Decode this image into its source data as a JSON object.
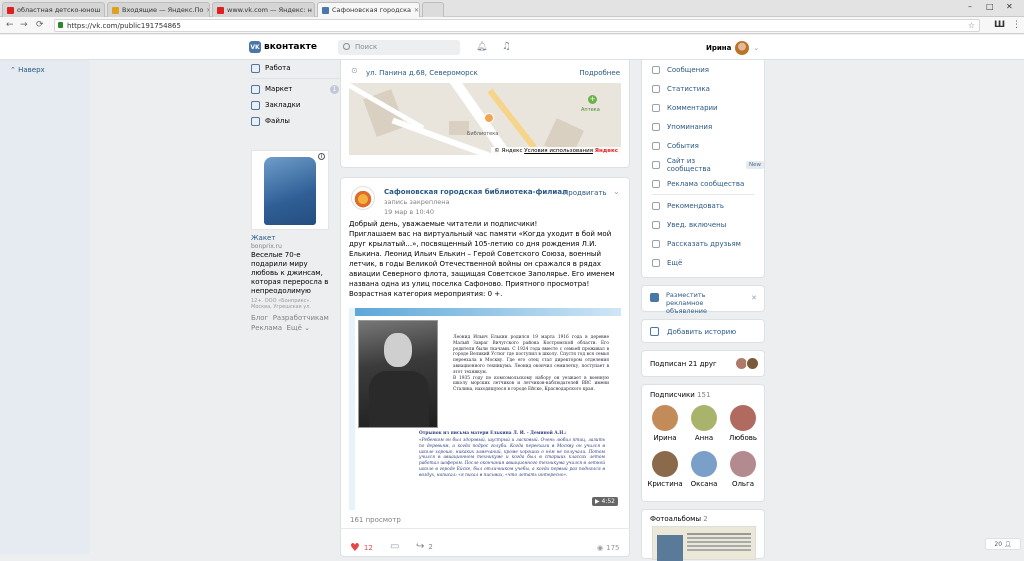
{
  "browser": {
    "tabs": [
      {
        "label": "областная детско-юнош",
        "color": "#e02020"
      },
      {
        "label": "Входящие — Яндекс.По",
        "color": "#e0a020"
      },
      {
        "label": "www.vk.com — Яндекс: н",
        "color": "#e02020"
      },
      {
        "label": "Сафоновская городска",
        "color": "#4a76a8"
      }
    ],
    "url": "https://vk.com/public191754865"
  },
  "vk": {
    "logo": "вконтакте",
    "search_placeholder": "Поиск",
    "user_name": "Ирина",
    "up": "Наверх"
  },
  "left_menu": [
    {
      "label": "Работа"
    },
    {
      "label": "Маркет",
      "badge": "1"
    },
    {
      "label": "Закладки"
    },
    {
      "label": "Файлы"
    }
  ],
  "ad": {
    "title": "Жакет",
    "site": "bonprix.ru",
    "text": "Веселые 70-е подарили миру любовь к джинсам, которая переросла в непреодолимую",
    "fine": "12+. ООО «Бонприкс». Москва, Угрешская ул."
  },
  "footer_links": [
    "Блог",
    "Разработчикам",
    "Реклама",
    "Ещё"
  ],
  "place": {
    "address": "ул. Панина д.68, Североморск",
    "more": "Подробнее",
    "map_copyright": "© Яндекс",
    "map_terms": "Условия использования",
    "map_brand": "Яндекс",
    "poi_pharmacy": "Аптека",
    "poi_library": "Библиотека"
  },
  "post": {
    "author": "Сафоновская городская библиотека-филиал",
    "pinned": "запись закреплена",
    "date": "19 мар в 10:40",
    "promote": "Продвигать",
    "text": "Добрый день, уважаемые читатели и подписчики!\nПриглашаем вас на виртуальный час памяти «Когда уходит в бой мой друг крылатый...», посвященный 105-летию со дня рождения Л.И. Елькина. Леонид Ильич Елькин – Герой Советского Союза, военный летчик, в годы Великой Отечественной войны он сражался в рядах авиации Северного флота, защищая Советское Заполярье. Его именем названа одна из улиц поселка Сафоново. Приятного просмотра!\nВозрастная категория мероприятия: 0 +.",
    "poster_text1": "Леонид Ильич Елькин родился 19 марта 1916 года в деревне Малый Завраг Вичугского района Костромской области. Его родители были ткачами. С 1924 года вместе с семьей проживал в городе Великий Устюг где поступил в школу. Спустя год вся семья переехала в Москву. Где его отец стал директором отделения авиационного техникума. Леонид окончил семилетку, поступает в этот техникум.\nВ 1935 году по комсомольскому набору он уезжает в военную школу морских летчиков и летчиков-наблюдателей ВВС имени Сталина, находящуюся в городе Ейске, Краснодарского края.",
    "poster_heading2": "Отрывок из письма матери Елькина Л. И. - Деминой А.Н.:",
    "poster_text2": "«Ребенком он был здоровый, шустрый и ласковый. Очень любил птиц, лазить по деревьям, а когда подрос голуби. Когда переехали в Москву он учился в школе хорошо, никаких замечаний, кроме хороших о нем не получали. Потом учился в авиационном техникуме и когда был в старших классах летом работал шофером. После окончания авиационного техникума учился в летной школе в городе Ейске, был отличником учебы, а когда первый раз поднялся в воздух, написал: «я писал в письмах, «что летать интересно».",
    "duration": "4:52",
    "views": "161 просмотр",
    "likes": "12",
    "shares": "2",
    "eye_count": "175"
  },
  "right_menu": [
    {
      "label": "Сообщения"
    },
    {
      "label": "Статистика"
    },
    {
      "label": "Комментарии"
    },
    {
      "label": "Упоминания"
    },
    {
      "label": "События"
    },
    {
      "label": "Сайт из сообщества",
      "badge": "New"
    },
    {
      "label": "Реклама сообщества"
    },
    {
      "label": "Рекомендовать"
    },
    {
      "label": "Увед. включены"
    },
    {
      "label": "Рассказать друзьям"
    },
    {
      "label": "Ещё"
    }
  ],
  "right_actions": {
    "promo": "Разместить рекламное объявление",
    "add_story": "Добавить историю",
    "friends_sub": "Подписан 21 друг",
    "subscribers": "Подписчики",
    "subscribers_count": "151",
    "albums": "Фотоальбомы",
    "albums_count": "2"
  },
  "subscribers": [
    {
      "name": "Ирина",
      "color": "#c48b5a"
    },
    {
      "name": "Анна",
      "color": "#a9b36b"
    },
    {
      "name": "Любовь",
      "color": "#b06a60"
    },
    {
      "name": "Кристина",
      "color": "#8a6a4a"
    },
    {
      "name": "Оксана",
      "color": "#7aa0c9"
    },
    {
      "name": "Ольга",
      "color": "#b38a8f"
    }
  ],
  "corner": "20"
}
